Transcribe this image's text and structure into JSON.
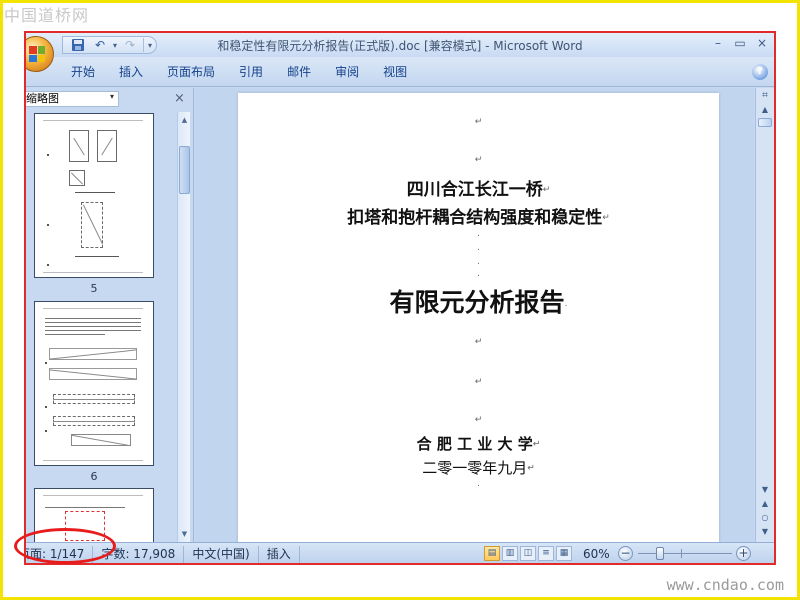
{
  "watermark": {
    "top": "中国道桥网",
    "bottom": "www.cndao.com"
  },
  "window": {
    "title": "和稳定性有限元分析报告(正式版).doc [兼容模式] - Microsoft Word",
    "controls": {
      "minimize": "–",
      "restore": "▭",
      "close": "×"
    },
    "ribbon_min_minimize": "–",
    "ribbon_min_restore": "▭",
    "ribbon_min_close": "×"
  },
  "qat": {
    "undo": "↶",
    "undo_drop": "▾",
    "redo": "↷",
    "customize": "▾"
  },
  "ribbon": {
    "tabs": [
      "开始",
      "插入",
      "页面布局",
      "引用",
      "邮件",
      "审阅",
      "视图"
    ],
    "help": "?"
  },
  "nav_pane": {
    "selected_view": "缩略图",
    "dropdown_arrow": "▾",
    "close": "×",
    "scroll_up": "▲",
    "scroll_down": "▼",
    "pages": [
      "5",
      "6"
    ]
  },
  "document": {
    "para_mark": "↵",
    "small_mark": ".",
    "title_line1": "四川合江长江一桥",
    "title_line2": "扣塔和抱杆耦合结构强度和稳定性",
    "title_main": "有限元分析报告",
    "org": "合 肥 工 业 大 学",
    "date": "二零一零年九月"
  },
  "v_scrollbar": {
    "ruler": "⌗",
    "up": "▲",
    "down": "▼",
    "prev_page": "▲",
    "select_browse": "○",
    "next_page": "▼"
  },
  "statusbar": {
    "page": "页面: 1/147",
    "words": "字数: 17,908",
    "language": "中文(中国)",
    "mode": "插入",
    "zoom": "60%",
    "zoom_out": "−",
    "zoom_in": "+",
    "view_icons": [
      "▤",
      "▥",
      "◫",
      "≡",
      "▦"
    ]
  }
}
